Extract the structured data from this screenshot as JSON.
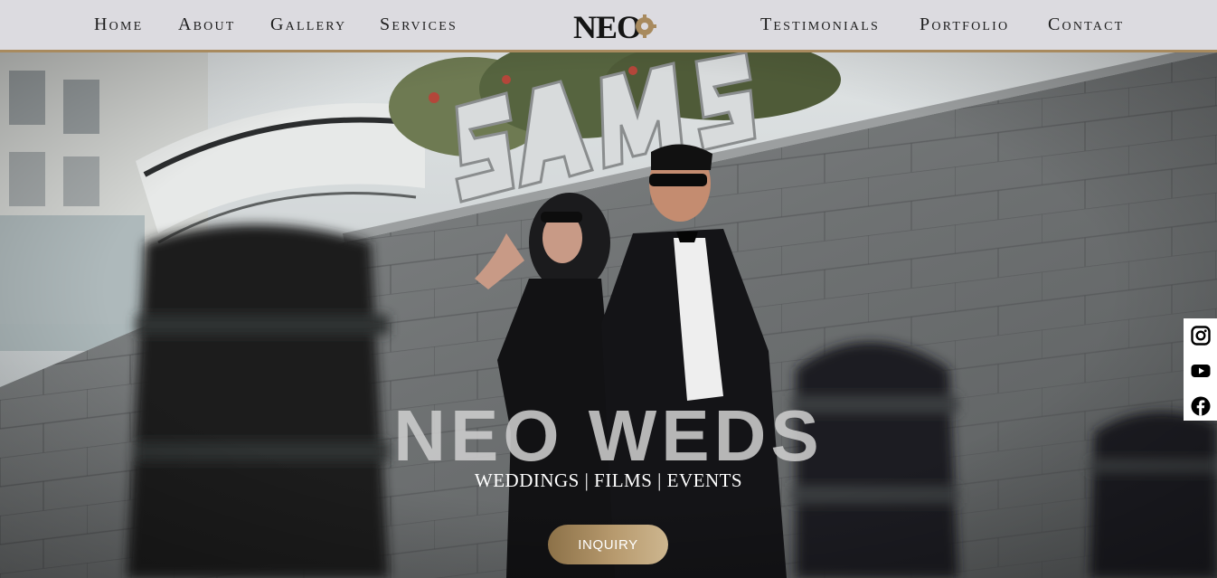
{
  "nav": {
    "left": [
      "Home",
      "About",
      "Gallery",
      "Services"
    ],
    "right": [
      "Testimonials",
      "Portfolio",
      "Contact"
    ]
  },
  "logo": {
    "text": "NEO"
  },
  "hero": {
    "title": "NEO WEDS",
    "subtitle": "WEDDINGS | FILMS | EVENTS",
    "cta": "INQUIRY"
  },
  "social": [
    {
      "name": "instagram-icon"
    },
    {
      "name": "youtube-icon"
    },
    {
      "name": "facebook-icon"
    }
  ],
  "colors": {
    "header_bg": "#dcdbe0",
    "accent_gold": "#a88a5e",
    "nav_text": "#1d1d1d",
    "button_gradient_start": "#8c7148",
    "button_gradient_end": "#cdb68f"
  }
}
